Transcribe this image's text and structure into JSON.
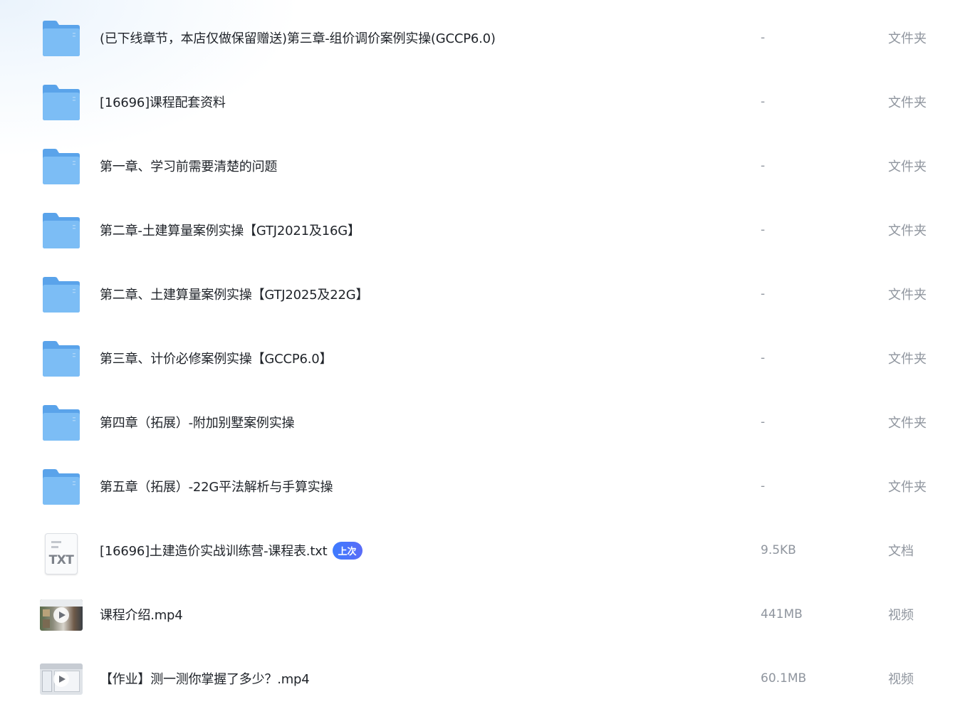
{
  "files": [
    {
      "name": "(已下线章节，本店仅做保留赠送)第三章-组价调价案例实操(GCCP6.0)",
      "size": "-",
      "type": "文件夹",
      "icon": "folder-icon"
    },
    {
      "name": "[16696]课程配套资料",
      "size": "-",
      "type": "文件夹",
      "icon": "folder-icon"
    },
    {
      "name": "第一章、学习前需要清楚的问题",
      "size": "-",
      "type": "文件夹",
      "icon": "folder-icon"
    },
    {
      "name": "第二章-土建算量案例实操【GTJ2021及16G】",
      "size": "-",
      "type": "文件夹",
      "icon": "folder-icon"
    },
    {
      "name": "第二章、土建算量案例实操【GTJ2025及22G】",
      "size": "-",
      "type": "文件夹",
      "icon": "folder-icon"
    },
    {
      "name": "第三章、计价必修案例实操【GCCP6.0】",
      "size": "-",
      "type": "文件夹",
      "icon": "folder-icon"
    },
    {
      "name": "第四章（拓展）-附加别墅案例实操",
      "size": "-",
      "type": "文件夹",
      "icon": "folder-icon"
    },
    {
      "name": "第五章（拓展）-22G平法解析与手算实操",
      "size": "-",
      "type": "文件夹",
      "icon": "folder-icon"
    },
    {
      "name": "[16696]土建造价实战训练营-课程表.txt",
      "badge": "上次",
      "size": "9.5KB",
      "type": "文档",
      "icon": "txt-file-icon",
      "icon_label": "TXT"
    },
    {
      "name": "课程介绍.mp4",
      "size": "441MB",
      "type": "视频",
      "icon": "video-thumbnail"
    },
    {
      "name": "【作业】测一测你掌握了多少？.mp4",
      "size": "60.1MB",
      "type": "视频",
      "icon": "video-thumbnail"
    }
  ],
  "colors": {
    "folder": "#5aa9ef",
    "badge": "#3d7bff",
    "muted_text": "#8f959e"
  }
}
